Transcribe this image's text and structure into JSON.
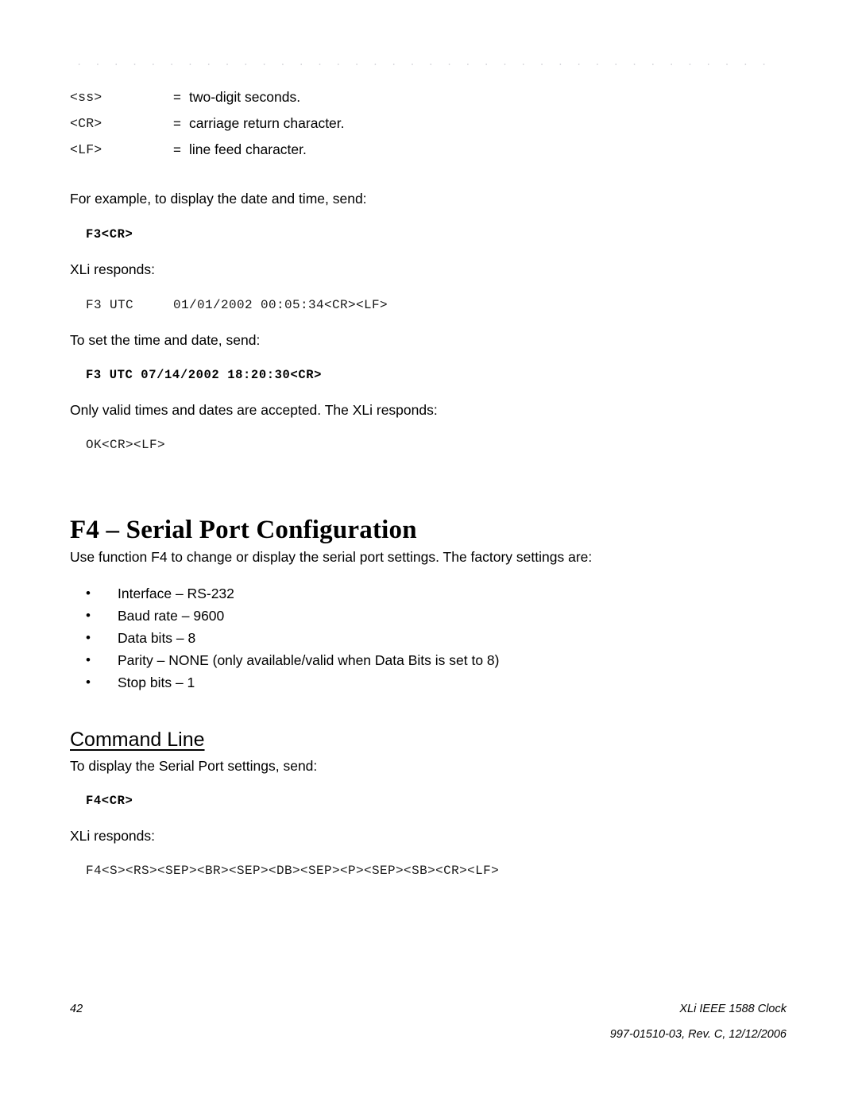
{
  "document": {
    "title": "XLi IEEE 1588 Clock",
    "page_number": "42",
    "footer_product": "XLi IEEE 1588 Clock",
    "footer_revision": "997-01510-03, Rev. C, 12/12/2006"
  },
  "definitions": [
    {
      "term": "<ss>",
      "eq": "=",
      "desc": "two-digit seconds."
    },
    {
      "term": "<CR>",
      "eq": "=",
      "desc": "carriage return character."
    },
    {
      "term": "<LF>",
      "eq": "=",
      "desc": "line feed character."
    }
  ],
  "f3_section": {
    "example_intro": "For example, to display the date and time, send:",
    "example_command": "F3<CR>",
    "responds_label_1": "XLi responds:",
    "example_response": "F3 UTC     01/01/2002 00:05:34<CR><LF>",
    "set_intro": "To set the time and date, send:",
    "set_command": "F3 UTC 07/14/2002 18:20:30<CR>",
    "valid_note": "Only valid times and dates are accepted. The XLi responds:",
    "ok_response": "OK<CR><LF>"
  },
  "f4_section": {
    "heading": "F4 – Serial Port Configuration",
    "intro": "Use function F4 to change or display the serial port settings. The factory settings are:",
    "bullet_mark": "•",
    "factory_settings": [
      "Interface – RS-232",
      "Baud rate – 9600",
      "Data bits – 8",
      "Parity – NONE (only available/valid when Data Bits is set to 8)",
      "Stop bits – 1"
    ],
    "subheading": "Command Line",
    "display_intro": "To display the Serial Port settings, send:",
    "display_command": "F4<CR>",
    "responds_label": "XLi responds:",
    "display_response": "F4<S><RS><SEP><BR><SEP><DB><SEP><P><SEP><SB><CR><LF>"
  }
}
